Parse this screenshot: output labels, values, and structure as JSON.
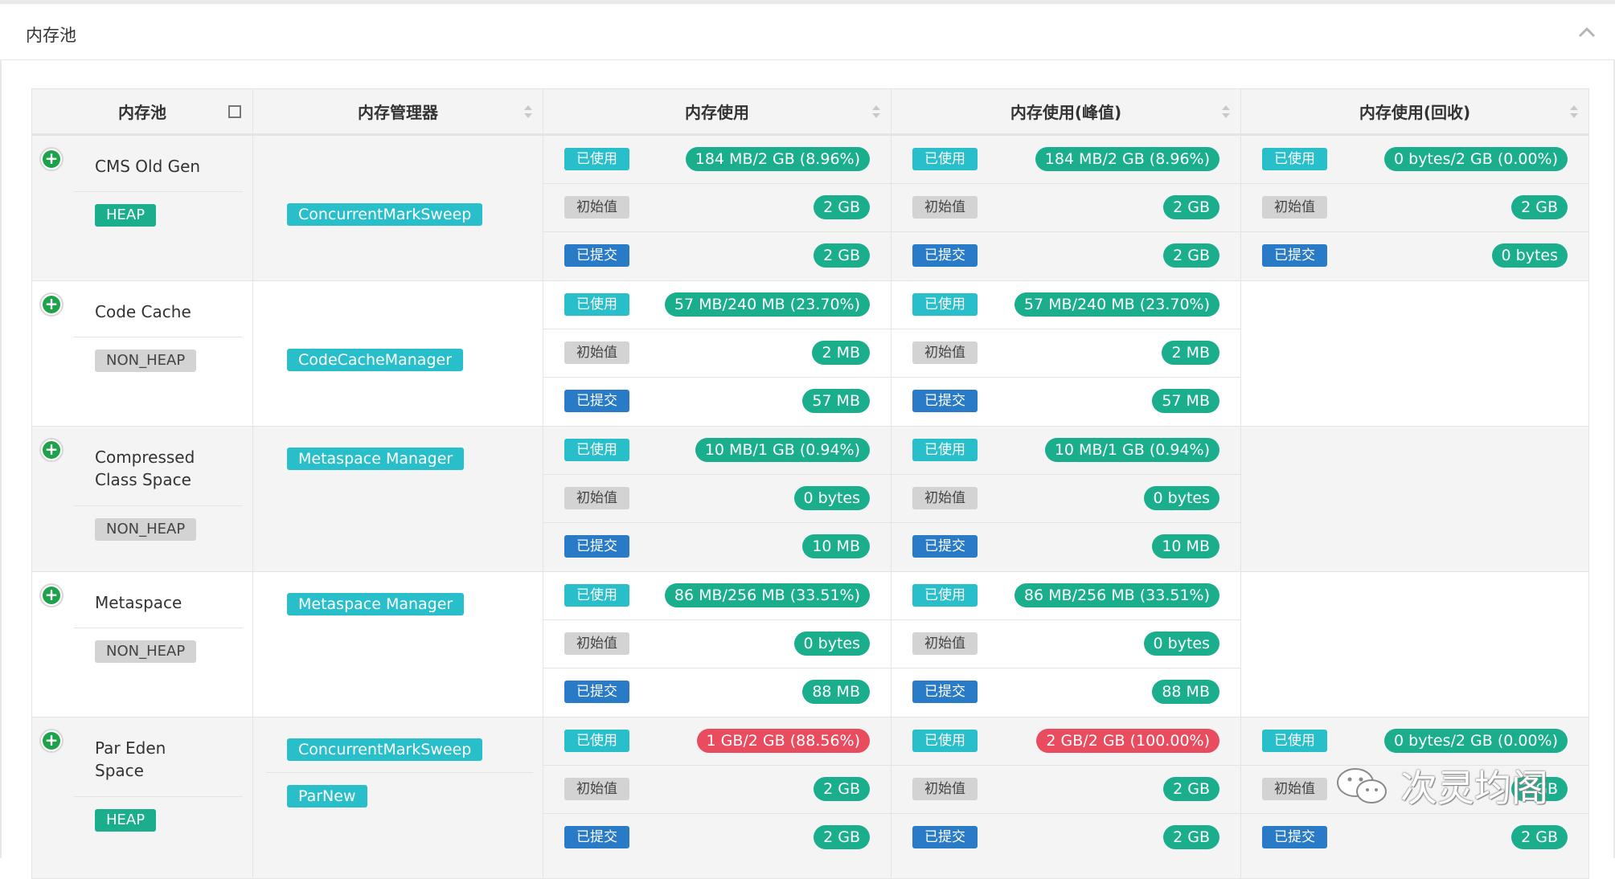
{
  "panel": {
    "title": "内存池",
    "collapse_icon": "chevron-up-icon"
  },
  "headers": [
    "内存池",
    "内存管理器",
    "内存使用",
    "内存使用(峰值)",
    "内存使用(回收)"
  ],
  "labels": {
    "used": "已使用",
    "init": "初始值",
    "committed": "已提交"
  },
  "colors": {
    "green": "#1aae8c",
    "cyan": "#28bfcb",
    "blue": "#2a7bc7",
    "red": "#e84c5e",
    "gray": "#d3d3d3"
  },
  "rows": [
    {
      "name": "CMS Old Gen",
      "type": "HEAP",
      "managers": [
        "ConcurrentMarkSweep"
      ],
      "usage": {
        "used": "184 MB/2 GB (8.96%)",
        "init": "2 GB",
        "committed": "2 GB"
      },
      "peak": {
        "used": "184 MB/2 GB (8.96%)",
        "init": "2 GB",
        "committed": "2 GB"
      },
      "collection": {
        "used": "0 bytes/2 GB (0.00%)",
        "init": "2 GB",
        "committed": "0 bytes"
      }
    },
    {
      "name": "Code Cache",
      "type": "NON_HEAP",
      "managers": [
        "CodeCacheManager"
      ],
      "usage": {
        "used": "57 MB/240 MB (23.70%)",
        "init": "2 MB",
        "committed": "57 MB"
      },
      "peak": {
        "used": "57 MB/240 MB (23.70%)",
        "init": "2 MB",
        "committed": "57 MB"
      }
    },
    {
      "name": "Compressed Class Space",
      "type": "NON_HEAP",
      "managers": [
        "Metaspace Manager"
      ],
      "usage": {
        "used": "10 MB/1 GB (0.94%)",
        "init": "0 bytes",
        "committed": "10 MB"
      },
      "peak": {
        "used": "10 MB/1 GB (0.94%)",
        "init": "0 bytes",
        "committed": "10 MB"
      }
    },
    {
      "name": "Metaspace",
      "type": "NON_HEAP",
      "managers": [
        "Metaspace Manager"
      ],
      "usage": {
        "used": "86 MB/256 MB (33.51%)",
        "init": "0 bytes",
        "committed": "88 MB"
      },
      "peak": {
        "used": "86 MB/256 MB (33.51%)",
        "init": "0 bytes",
        "committed": "88 MB"
      }
    },
    {
      "name": "Par Eden Space",
      "type": "HEAP",
      "managers": [
        "ConcurrentMarkSweep",
        "ParNew"
      ],
      "usage": {
        "used": "1 GB/2 GB (88.56%)",
        "init": "2 GB",
        "committed": "2 GB"
      },
      "peak": {
        "used": "2 GB/2 GB (100.00%)",
        "init": "2 GB",
        "committed": "2 GB"
      },
      "collection": {
        "used": "0 bytes/2 GB (0.00%)",
        "init": "2 GB",
        "committed": "2 GB"
      }
    }
  ],
  "watermark": {
    "text": "次灵均阁",
    "icon": "wechat-icon"
  }
}
